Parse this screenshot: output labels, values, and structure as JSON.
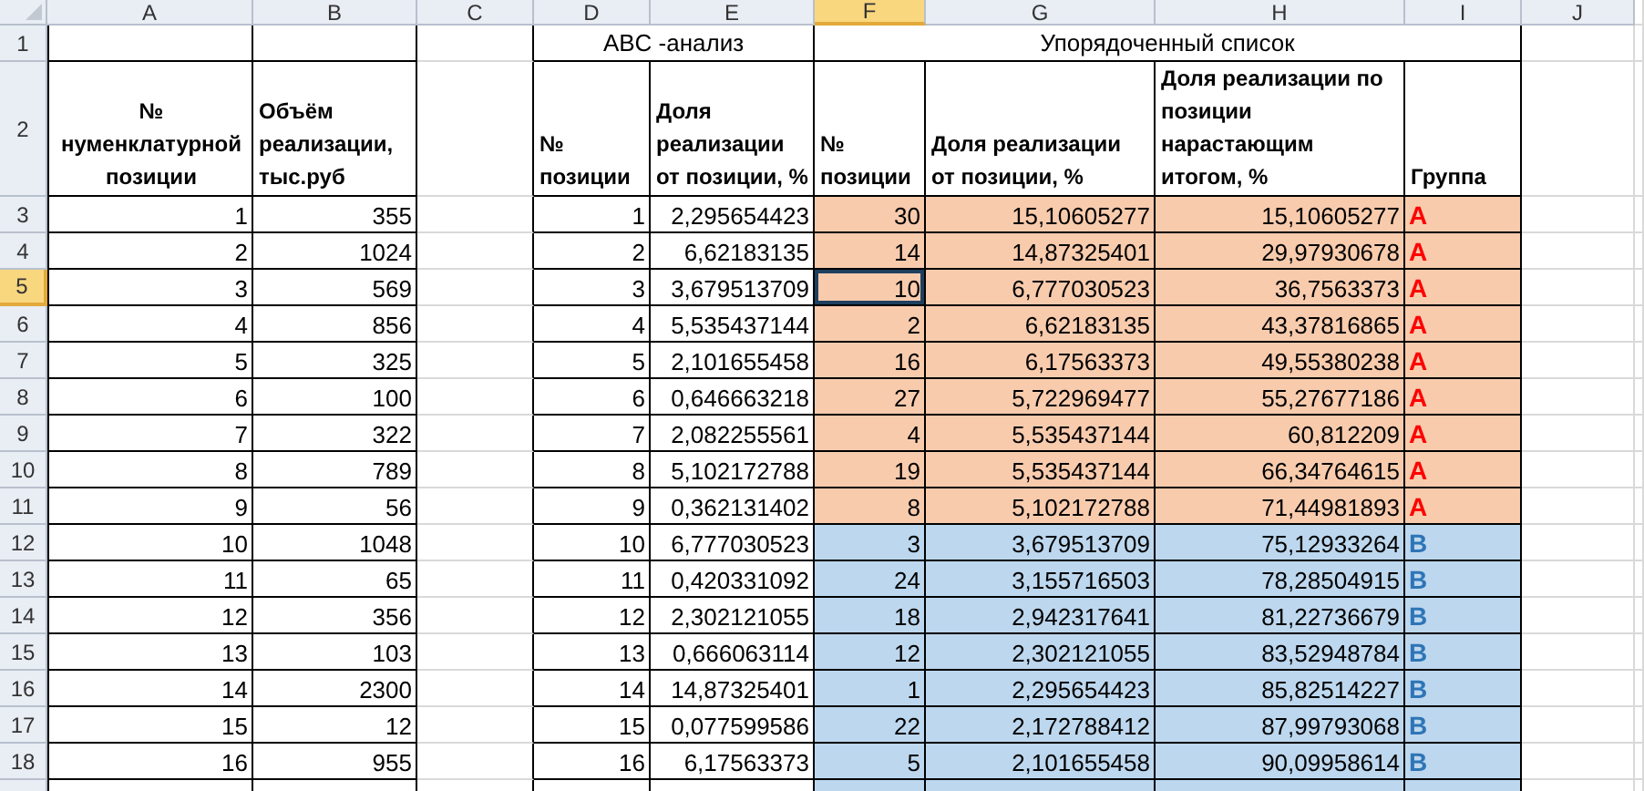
{
  "columns": [
    {
      "label": "A",
      "selected": false
    },
    {
      "label": "B",
      "selected": false
    },
    {
      "label": "C",
      "selected": false
    },
    {
      "label": "D",
      "selected": false
    },
    {
      "label": "E",
      "selected": false
    },
    {
      "label": "F",
      "selected": true
    },
    {
      "label": "G",
      "selected": false
    },
    {
      "label": "H",
      "selected": false
    },
    {
      "label": "I",
      "selected": false
    },
    {
      "label": "J",
      "selected": false
    }
  ],
  "title_row": {
    "number": "1",
    "selected": false,
    "abc_title": "ABC -анализ",
    "sorted_title": "Упорядоченный список"
  },
  "header_row": {
    "number": "2",
    "selected": false,
    "headers": [
      "№ нуменклатурной позиции",
      "Объём реализации, тыс.руб",
      "№ позиции",
      "Доля реализации от позиции, %",
      "№ позиции",
      "Доля реализации от позиции, %",
      "Доля реализации по позиции нарастающим итогом, %",
      "Группа"
    ]
  },
  "rows": [
    {
      "number": "3",
      "selected": false,
      "kind": "group_a",
      "cells": [
        "1",
        "355",
        "1",
        "2,295654423",
        "30",
        "15,10605277",
        "15,10605277",
        "A"
      ]
    },
    {
      "number": "4",
      "selected": false,
      "kind": "group_a",
      "cells": [
        "2",
        "1024",
        "2",
        "6,62183135",
        "14",
        "14,87325401",
        "29,97930678",
        "A"
      ]
    },
    {
      "number": "5",
      "selected": true,
      "kind": "group_a",
      "cells": [
        "3",
        "569",
        "3",
        "3,679513709",
        "10",
        "6,777030523",
        "36,7563373",
        "A"
      ]
    },
    {
      "number": "6",
      "selected": false,
      "kind": "group_a",
      "cells": [
        "4",
        "856",
        "4",
        "5,535437144",
        "2",
        "6,62183135",
        "43,37816865",
        "A"
      ]
    },
    {
      "number": "7",
      "selected": false,
      "kind": "group_a",
      "cells": [
        "5",
        "325",
        "5",
        "2,101655458",
        "16",
        "6,17563373",
        "49,55380238",
        "A"
      ]
    },
    {
      "number": "8",
      "selected": false,
      "kind": "group_a",
      "cells": [
        "6",
        "100",
        "6",
        "0,646663218",
        "27",
        "5,722969477",
        "55,27677186",
        "A"
      ]
    },
    {
      "number": "9",
      "selected": false,
      "kind": "group_a",
      "cells": [
        "7",
        "322",
        "7",
        "2,082255561",
        "4",
        "5,535437144",
        "60,812209",
        "A"
      ]
    },
    {
      "number": "10",
      "selected": false,
      "kind": "group_a",
      "cells": [
        "8",
        "789",
        "8",
        "5,102172788",
        "19",
        "5,535437144",
        "66,34764615",
        "A"
      ]
    },
    {
      "number": "11",
      "selected": false,
      "kind": "group_a",
      "cells": [
        "9",
        "56",
        "9",
        "0,362131402",
        "8",
        "5,102172788",
        "71,44981893",
        "A"
      ]
    },
    {
      "number": "12",
      "selected": false,
      "kind": "group_b",
      "cells": [
        "10",
        "1048",
        "10",
        "6,777030523",
        "3",
        "3,679513709",
        "75,12933264",
        "B"
      ]
    },
    {
      "number": "13",
      "selected": false,
      "kind": "group_b",
      "cells": [
        "11",
        "65",
        "11",
        "0,420331092",
        "24",
        "3,155716503",
        "78,28504915",
        "B"
      ]
    },
    {
      "number": "14",
      "selected": false,
      "kind": "group_b",
      "cells": [
        "12",
        "356",
        "12",
        "2,302121055",
        "18",
        "2,942317641",
        "81,22736679",
        "B"
      ]
    },
    {
      "number": "15",
      "selected": false,
      "kind": "group_b",
      "cells": [
        "13",
        "103",
        "13",
        "0,666063114",
        "12",
        "2,302121055",
        "83,52948784",
        "B"
      ]
    },
    {
      "number": "16",
      "selected": false,
      "kind": "group_b",
      "cells": [
        "14",
        "2300",
        "14",
        "14,87325401",
        "1",
        "2,295654423",
        "85,82514227",
        "B"
      ]
    },
    {
      "number": "17",
      "selected": false,
      "kind": "group_b",
      "cells": [
        "15",
        "12",
        "15",
        "0,077599586",
        "22",
        "2,172788412",
        "87,99793068",
        "B"
      ]
    },
    {
      "number": "18",
      "selected": false,
      "kind": "group_b",
      "cells": [
        "16",
        "955",
        "16",
        "6,17563373",
        "5",
        "2,101655458",
        "90,09958614",
        "B"
      ]
    }
  ]
}
